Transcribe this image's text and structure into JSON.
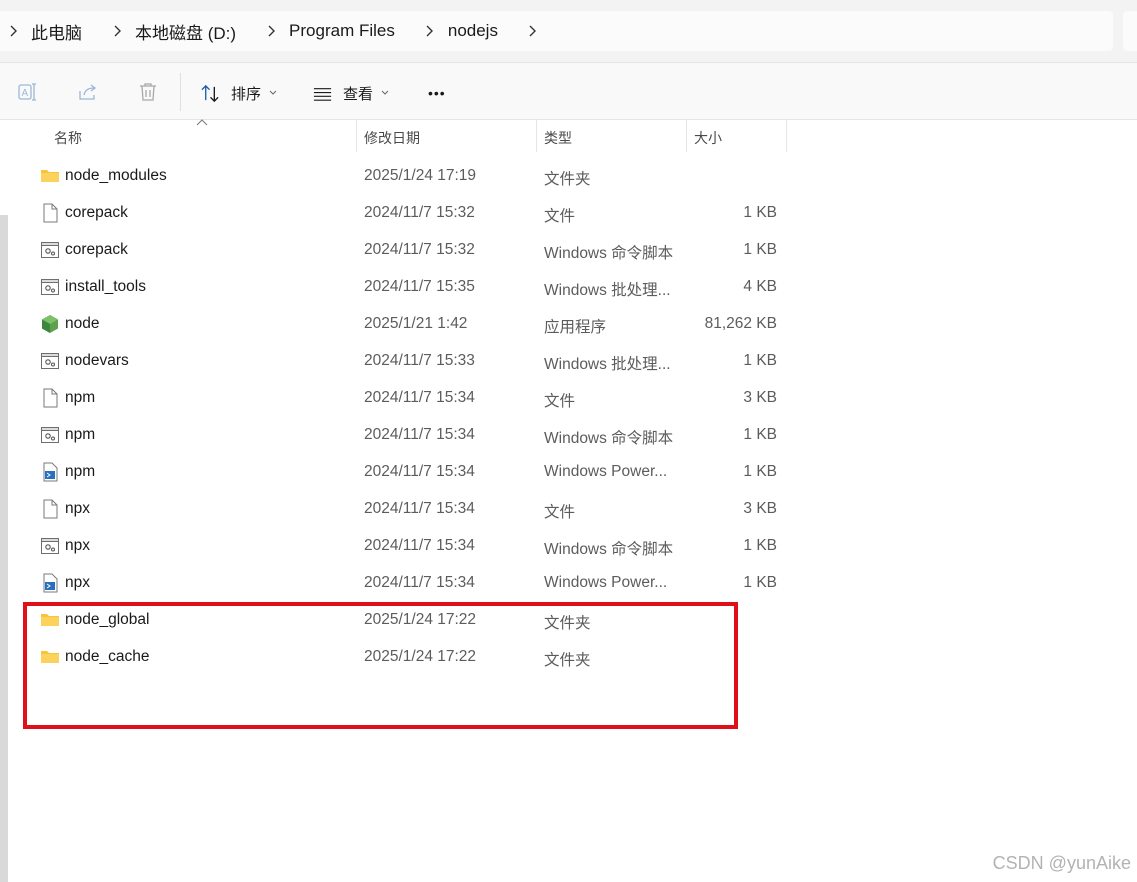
{
  "breadcrumb": [
    "此电脑",
    "本地磁盘 (D:)",
    "Program Files",
    "nodejs"
  ],
  "toolbar": {
    "sort_label": "排序",
    "view_label": "查看",
    "more_label": "•••"
  },
  "columns": {
    "name": "名称",
    "modified": "修改日期",
    "type": "类型",
    "size": "大小"
  },
  "files": [
    {
      "name": "node_modules",
      "modified": "2025/1/24 17:19",
      "type": "文件夹",
      "size": "",
      "icon": "folder-icon"
    },
    {
      "name": "corepack",
      "modified": "2024/11/7 15:32",
      "type": "文件",
      "size": "1 KB",
      "icon": "file-icon"
    },
    {
      "name": "corepack",
      "modified": "2024/11/7 15:32",
      "type": "Windows 命令脚本",
      "size": "1 KB",
      "icon": "script-icon"
    },
    {
      "name": "install_tools",
      "modified": "2024/11/7 15:35",
      "type": "Windows 批处理...",
      "size": "4 KB",
      "icon": "script-icon"
    },
    {
      "name": "node",
      "modified": "2025/1/21 1:42",
      "type": "应用程序",
      "size": "81,262 KB",
      "icon": "nodejs-icon"
    },
    {
      "name": "nodevars",
      "modified": "2024/11/7 15:33",
      "type": "Windows 批处理...",
      "size": "1 KB",
      "icon": "script-icon"
    },
    {
      "name": "npm",
      "modified": "2024/11/7 15:34",
      "type": "文件",
      "size": "3 KB",
      "icon": "file-icon"
    },
    {
      "name": "npm",
      "modified": "2024/11/7 15:34",
      "type": "Windows 命令脚本",
      "size": "1 KB",
      "icon": "script-icon"
    },
    {
      "name": "npm",
      "modified": "2024/11/7 15:34",
      "type": "Windows Power...",
      "size": "1 KB",
      "icon": "powershell-icon"
    },
    {
      "name": "npx",
      "modified": "2024/11/7 15:34",
      "type": "文件",
      "size": "3 KB",
      "icon": "file-icon"
    },
    {
      "name": "npx",
      "modified": "2024/11/7 15:34",
      "type": "Windows 命令脚本",
      "size": "1 KB",
      "icon": "script-icon"
    },
    {
      "name": "npx",
      "modified": "2024/11/7 15:34",
      "type": "Windows Power...",
      "size": "1 KB",
      "icon": "powershell-icon"
    },
    {
      "name": "node_global",
      "modified": "2025/1/24 17:22",
      "type": "文件夹",
      "size": "",
      "icon": "folder-icon"
    },
    {
      "name": "node_cache",
      "modified": "2025/1/24 17:22",
      "type": "文件夹",
      "size": "",
      "icon": "folder-icon"
    }
  ],
  "watermark": "CSDN @yunAike",
  "colors": {
    "highlight": "#e0101a",
    "folder": "#f8c43a",
    "node": "#5fa04e"
  }
}
